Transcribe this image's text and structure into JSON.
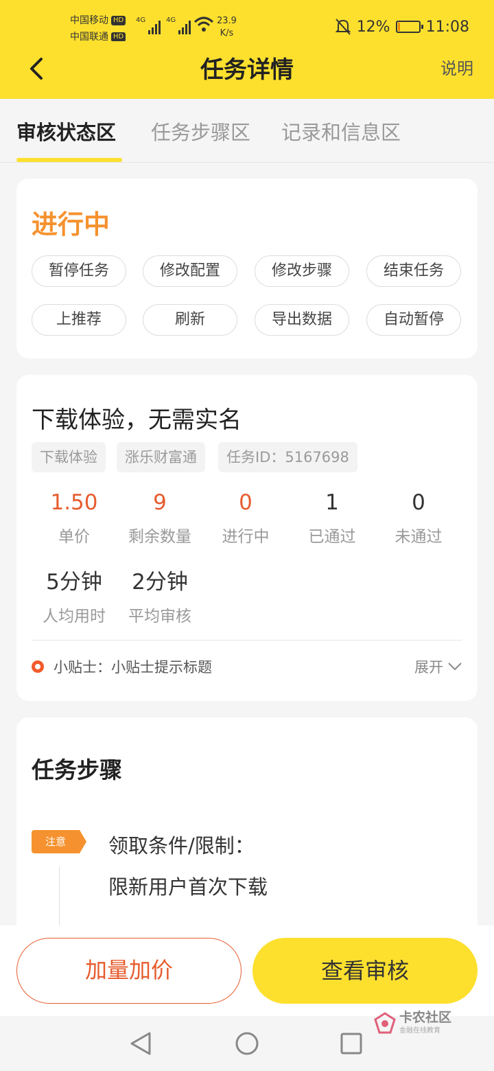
{
  "status_bar": {
    "carrier1": "中国移动",
    "carrier2": "中国联通",
    "hd_badge": "HD",
    "net_badge": "4G",
    "speed_value": "23.9",
    "speed_unit": "K/s",
    "battery_text": "12%",
    "battery_level": 0.12,
    "time": "11:08",
    "icons": [
      "signal-icon",
      "wifi-icon",
      "mute-bell-icon",
      "battery-icon"
    ]
  },
  "nav": {
    "title": "任务详情",
    "help": "说明",
    "back_icon": "chevron-left-icon"
  },
  "tabs": [
    {
      "label": "审核状态区",
      "active": true
    },
    {
      "label": "任务步骤区",
      "active": false
    },
    {
      "label": "记录和信息区",
      "active": false
    }
  ],
  "status_card": {
    "title": "进行中",
    "buttons": [
      "暂停任务",
      "修改配置",
      "修改步骤",
      "结束任务",
      "上推荐",
      "刷新",
      "导出数据",
      "自动暂停"
    ]
  },
  "info_card": {
    "task_name": "下载体验，无需实名",
    "tags": [
      "下载体验",
      "涨乐财富通",
      "任务ID：5167698"
    ],
    "stats": [
      {
        "value": "1.50",
        "label": "单价"
      },
      {
        "value": "9",
        "label": "剩余数量"
      },
      {
        "value": "0",
        "label": "进行中"
      },
      {
        "value": "1",
        "label": "已通过"
      },
      {
        "value": "0",
        "label": "未通过"
      }
    ],
    "stats2": [
      {
        "value": "5分钟",
        "label": "人均用时"
      },
      {
        "value": "2分钟",
        "label": "平均审核"
      }
    ],
    "tip": "小贴士：小贴士提示标题",
    "expand": "展开"
  },
  "steps_card": {
    "title": "任务步骤",
    "badge": "注意",
    "line1": "领取条件/限制：",
    "line2": "限新用户首次下载"
  },
  "bottom": {
    "left_button": "加量加价",
    "right_button": "查看审核"
  },
  "watermark": {
    "title": "卡农社区",
    "subtitle": "金融在线教育"
  },
  "colors": {
    "brand_yellow": "#fde02e",
    "accent_orange": "#f5922f",
    "accent_red": "#e65c2e"
  }
}
